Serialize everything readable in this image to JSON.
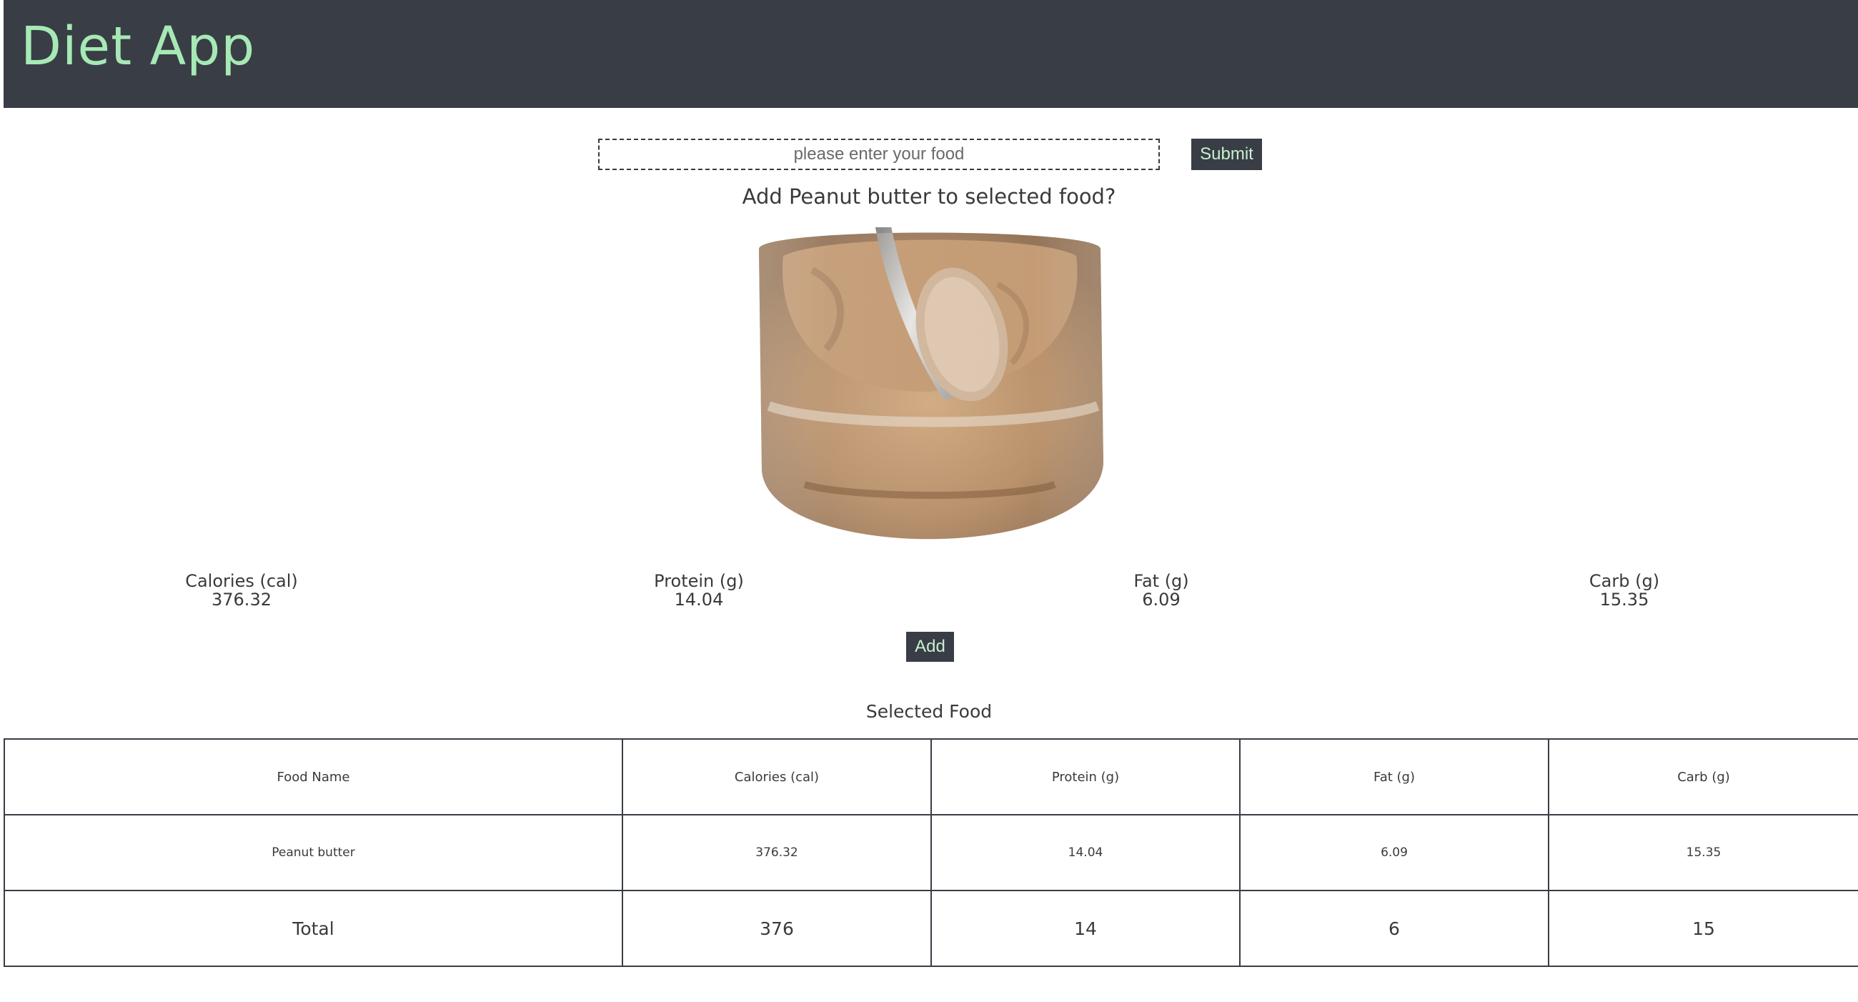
{
  "header": {
    "title": "Diet App"
  },
  "search": {
    "placeholder": "please enter your food",
    "value": ""
  },
  "submit_label": "Submit",
  "prompt": "Add Peanut butter to selected food?",
  "food_image": {
    "alt": "Peanut butter"
  },
  "nutrients": [
    {
      "label": "Calories (cal)",
      "value": "376.32"
    },
    {
      "label": "Protein (g)",
      "value": "14.04"
    },
    {
      "label": "Fat (g)",
      "value": "6.09"
    },
    {
      "label": "Carb (g)",
      "value": "15.35"
    }
  ],
  "add_label": "Add",
  "selected_table": {
    "caption": "Selected Food",
    "columns": [
      "Food Name",
      "Calories (cal)",
      "Protein (g)",
      "Fat (g)",
      "Carb (g)"
    ],
    "rows": [
      [
        "Peanut butter",
        "376.32",
        "14.04",
        "6.09",
        "15.35"
      ]
    ],
    "total": [
      "Total",
      "376",
      "14",
      "6",
      "15"
    ]
  },
  "colors": {
    "header_bg": "#393d45",
    "accent": "#a6e9b5",
    "text": "#3a3a3a"
  }
}
